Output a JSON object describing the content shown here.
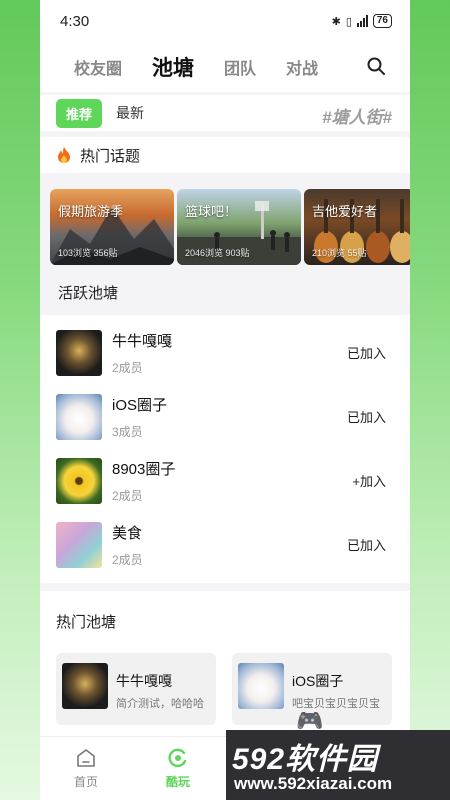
{
  "status": {
    "time": "4:30",
    "battery": "76"
  },
  "tabs": [
    "校友圈",
    "池塘",
    "团队",
    "对战"
  ],
  "active_tab": "池塘",
  "subtabs": {
    "chip": "推荐",
    "latest": "最新",
    "tag": "#塘人街#"
  },
  "hot_topics": {
    "title": "热门话题",
    "banners": [
      {
        "title": "假期旅游季",
        "stats": "103浏览 356贴"
      },
      {
        "title": "篮球吧！",
        "stats": "2046浏览 903贴"
      },
      {
        "title": "吉他爱好者",
        "stats": "210浏览 55贴"
      }
    ]
  },
  "active_ponds": {
    "title": "活跃池塘",
    "items": [
      {
        "name": "牛牛嘎嘎",
        "members": "2成员",
        "status": "已加入"
      },
      {
        "name": "iOS圈子",
        "members": "3成员",
        "status": "已加入"
      },
      {
        "name": "8903圈子",
        "members": "2成员",
        "status": "+加入"
      },
      {
        "name": "美食",
        "members": "2成员",
        "status": "已加入"
      }
    ]
  },
  "hot_ponds": {
    "title": "热门池塘",
    "cards": [
      {
        "name": "牛牛嘎嘎",
        "desc": "简介测试，哈哈哈"
      },
      {
        "name": "iOS圈子",
        "desc": "吧宝贝宝贝宝贝宝"
      }
    ]
  },
  "nav": {
    "home": "首页",
    "play": "酷玩"
  },
  "watermark": {
    "brand": "592软件园",
    "url": "www.592xiazai.com"
  },
  "colors": {
    "accent": "#5ed65a",
    "background_gradient_top": "#63c95a"
  }
}
